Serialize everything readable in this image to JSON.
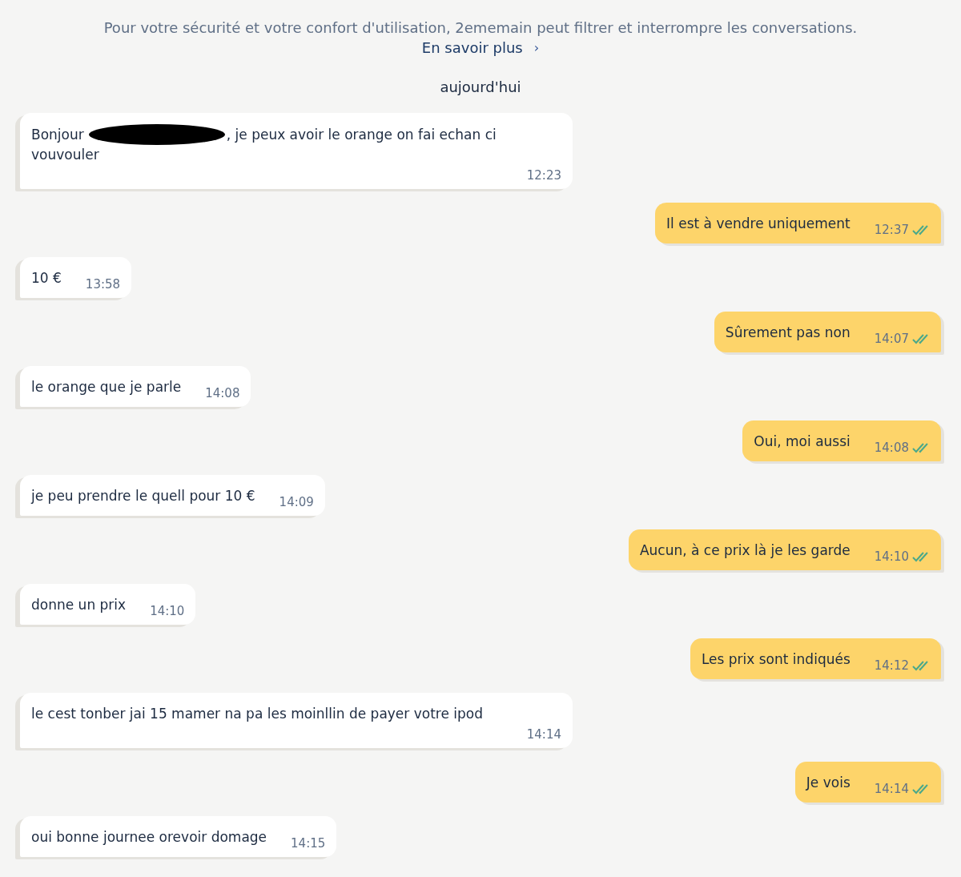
{
  "notice": {
    "text": "Pour votre sécurité et votre confort d'utilisation, 2ememain peut filtrer et interrompre les conversations.",
    "link": "En savoir plus",
    "link_icon": "›"
  },
  "date_separator": "aujourd'hui",
  "messages": [
    {
      "kind": "received",
      "wide": true,
      "redacted": true,
      "parts": [
        "Bonjour",
        ", je peux avoir le orange on fai echan ci",
        "vouvouler"
      ],
      "time": "12:23"
    },
    {
      "kind": "sent",
      "wide": false,
      "read": true,
      "parts": [
        "Il est à vendre uniquement"
      ],
      "time": "12:37"
    },
    {
      "kind": "received",
      "wide": false,
      "parts": [
        "10 €"
      ],
      "time": "13:58"
    },
    {
      "kind": "sent",
      "wide": false,
      "read": true,
      "parts": [
        "Sûrement pas non"
      ],
      "time": "14:07"
    },
    {
      "kind": "received",
      "wide": false,
      "parts": [
        "le orange que je parle"
      ],
      "time": "14:08"
    },
    {
      "kind": "sent",
      "wide": false,
      "read": true,
      "parts": [
        "Oui, moi aussi"
      ],
      "time": "14:08"
    },
    {
      "kind": "received",
      "wide": false,
      "parts": [
        "je peu prendre le quell pour 10 €"
      ],
      "time": "14:09"
    },
    {
      "kind": "sent",
      "wide": false,
      "read": true,
      "parts": [
        "Aucun, à ce prix là je les garde"
      ],
      "time": "14:10"
    },
    {
      "kind": "received",
      "wide": false,
      "parts": [
        "donne un prix"
      ],
      "time": "14:10"
    },
    {
      "kind": "sent",
      "wide": false,
      "read": true,
      "parts": [
        "Les prix sont indiqués"
      ],
      "time": "14:12"
    },
    {
      "kind": "received",
      "wide": true,
      "parts": [
        "le cest tonber jai 15 mamer na pa les moinllin de payer votre ipod"
      ],
      "time": "14:14"
    },
    {
      "kind": "sent",
      "wide": false,
      "read": true,
      "parts": [
        "Je vois"
      ],
      "time": "14:14"
    },
    {
      "kind": "received",
      "wide": false,
      "parts": [
        "oui bonne journee orevoir domage"
      ],
      "time": "14:15"
    }
  ]
}
